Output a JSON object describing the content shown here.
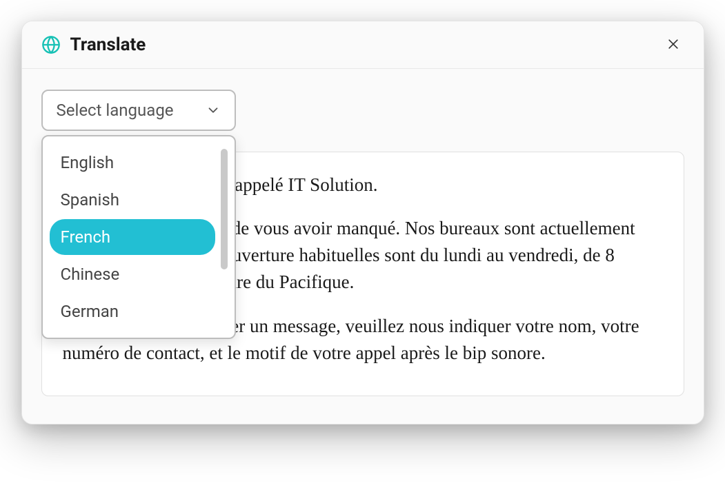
{
  "header": {
    "title": "Translate"
  },
  "select": {
    "placeholder": "Select language",
    "options": [
      {
        "label": "English",
        "selected": false
      },
      {
        "label": "Spanish",
        "selected": false
      },
      {
        "label": "French",
        "selected": true
      },
      {
        "label": "Chinese",
        "selected": false
      },
      {
        "label": "German",
        "selected": false
      }
    ]
  },
  "content": {
    "paragraphs": [
      "Bonjour, merci d'avoir appelé IT Solution.",
      "Nous sommes désolés de vous avoir manqué. Nos bureaux sont actuellement fermés. Nos heures d'ouverture habituelles sont du lundi au vendredi, de 8 heures à 17 heures, heure du Pacifique.",
      "Si vous souhaitez laisser un message, veuillez nous indiquer votre nom, votre numéro de contact, et le motif de votre appel après le bip sonore."
    ]
  }
}
